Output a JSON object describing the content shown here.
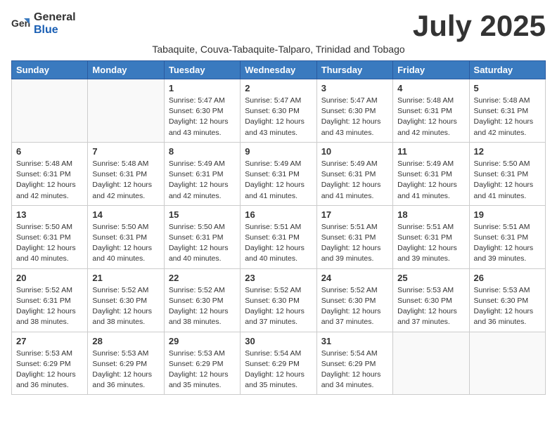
{
  "logo": {
    "general": "General",
    "blue": "Blue"
  },
  "title": "July 2025",
  "subtitle": "Tabaquite, Couva-Tabaquite-Talparo, Trinidad and Tobago",
  "days_of_week": [
    "Sunday",
    "Monday",
    "Tuesday",
    "Wednesday",
    "Thursday",
    "Friday",
    "Saturday"
  ],
  "weeks": [
    [
      {
        "day": "",
        "info": ""
      },
      {
        "day": "",
        "info": ""
      },
      {
        "day": "1",
        "info": "Sunrise: 5:47 AM\nSunset: 6:30 PM\nDaylight: 12 hours and 43 minutes."
      },
      {
        "day": "2",
        "info": "Sunrise: 5:47 AM\nSunset: 6:30 PM\nDaylight: 12 hours and 43 minutes."
      },
      {
        "day": "3",
        "info": "Sunrise: 5:47 AM\nSunset: 6:30 PM\nDaylight: 12 hours and 43 minutes."
      },
      {
        "day": "4",
        "info": "Sunrise: 5:48 AM\nSunset: 6:31 PM\nDaylight: 12 hours and 42 minutes."
      },
      {
        "day": "5",
        "info": "Sunrise: 5:48 AM\nSunset: 6:31 PM\nDaylight: 12 hours and 42 minutes."
      }
    ],
    [
      {
        "day": "6",
        "info": "Sunrise: 5:48 AM\nSunset: 6:31 PM\nDaylight: 12 hours and 42 minutes."
      },
      {
        "day": "7",
        "info": "Sunrise: 5:48 AM\nSunset: 6:31 PM\nDaylight: 12 hours and 42 minutes."
      },
      {
        "day": "8",
        "info": "Sunrise: 5:49 AM\nSunset: 6:31 PM\nDaylight: 12 hours and 42 minutes."
      },
      {
        "day": "9",
        "info": "Sunrise: 5:49 AM\nSunset: 6:31 PM\nDaylight: 12 hours and 41 minutes."
      },
      {
        "day": "10",
        "info": "Sunrise: 5:49 AM\nSunset: 6:31 PM\nDaylight: 12 hours and 41 minutes."
      },
      {
        "day": "11",
        "info": "Sunrise: 5:49 AM\nSunset: 6:31 PM\nDaylight: 12 hours and 41 minutes."
      },
      {
        "day": "12",
        "info": "Sunrise: 5:50 AM\nSunset: 6:31 PM\nDaylight: 12 hours and 41 minutes."
      }
    ],
    [
      {
        "day": "13",
        "info": "Sunrise: 5:50 AM\nSunset: 6:31 PM\nDaylight: 12 hours and 40 minutes."
      },
      {
        "day": "14",
        "info": "Sunrise: 5:50 AM\nSunset: 6:31 PM\nDaylight: 12 hours and 40 minutes."
      },
      {
        "day": "15",
        "info": "Sunrise: 5:50 AM\nSunset: 6:31 PM\nDaylight: 12 hours and 40 minutes."
      },
      {
        "day": "16",
        "info": "Sunrise: 5:51 AM\nSunset: 6:31 PM\nDaylight: 12 hours and 40 minutes."
      },
      {
        "day": "17",
        "info": "Sunrise: 5:51 AM\nSunset: 6:31 PM\nDaylight: 12 hours and 39 minutes."
      },
      {
        "day": "18",
        "info": "Sunrise: 5:51 AM\nSunset: 6:31 PM\nDaylight: 12 hours and 39 minutes."
      },
      {
        "day": "19",
        "info": "Sunrise: 5:51 AM\nSunset: 6:31 PM\nDaylight: 12 hours and 39 minutes."
      }
    ],
    [
      {
        "day": "20",
        "info": "Sunrise: 5:52 AM\nSunset: 6:31 PM\nDaylight: 12 hours and 38 minutes."
      },
      {
        "day": "21",
        "info": "Sunrise: 5:52 AM\nSunset: 6:30 PM\nDaylight: 12 hours and 38 minutes."
      },
      {
        "day": "22",
        "info": "Sunrise: 5:52 AM\nSunset: 6:30 PM\nDaylight: 12 hours and 38 minutes."
      },
      {
        "day": "23",
        "info": "Sunrise: 5:52 AM\nSunset: 6:30 PM\nDaylight: 12 hours and 37 minutes."
      },
      {
        "day": "24",
        "info": "Sunrise: 5:52 AM\nSunset: 6:30 PM\nDaylight: 12 hours and 37 minutes."
      },
      {
        "day": "25",
        "info": "Sunrise: 5:53 AM\nSunset: 6:30 PM\nDaylight: 12 hours and 37 minutes."
      },
      {
        "day": "26",
        "info": "Sunrise: 5:53 AM\nSunset: 6:30 PM\nDaylight: 12 hours and 36 minutes."
      }
    ],
    [
      {
        "day": "27",
        "info": "Sunrise: 5:53 AM\nSunset: 6:29 PM\nDaylight: 12 hours and 36 minutes."
      },
      {
        "day": "28",
        "info": "Sunrise: 5:53 AM\nSunset: 6:29 PM\nDaylight: 12 hours and 36 minutes."
      },
      {
        "day": "29",
        "info": "Sunrise: 5:53 AM\nSunset: 6:29 PM\nDaylight: 12 hours and 35 minutes."
      },
      {
        "day": "30",
        "info": "Sunrise: 5:54 AM\nSunset: 6:29 PM\nDaylight: 12 hours and 35 minutes."
      },
      {
        "day": "31",
        "info": "Sunrise: 5:54 AM\nSunset: 6:29 PM\nDaylight: 12 hours and 34 minutes."
      },
      {
        "day": "",
        "info": ""
      },
      {
        "day": "",
        "info": ""
      }
    ]
  ]
}
